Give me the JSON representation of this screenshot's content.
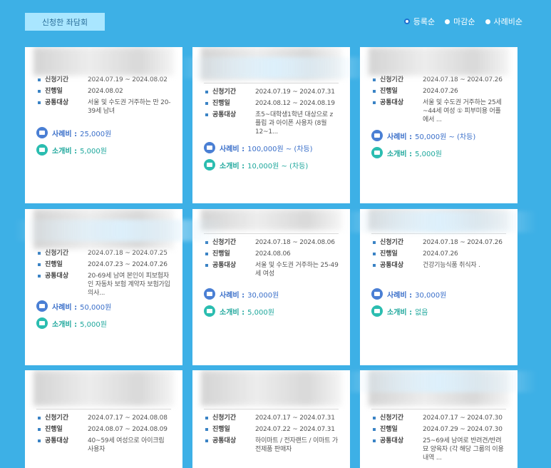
{
  "header": {
    "tab_label": "신청한 좌담회",
    "sort_options": [
      {
        "label": "등록순",
        "selected": true
      },
      {
        "label": "마감순",
        "selected": false
      },
      {
        "label": "사례비순",
        "selected": false
      }
    ]
  },
  "labels": {
    "period": "신청기간",
    "date": "진행일",
    "target": "공통대상",
    "fee": "사례비 :",
    "referral": "소개비 :"
  },
  "cards": [
    {
      "period": "2024.07.19 ~ 2024.08.02",
      "date": "2024.08.02",
      "target": "서울 및 수도권 거주하는 만 20-39세 남녀",
      "fee": "25,000원",
      "referral": "5,000원"
    },
    {
      "period": "2024.07.19 ~ 2024.07.31",
      "date": "2024.08.12 ~ 2024.08.19",
      "target": "초5~대학생1학년 대상으로 z플립 과 아이폰 사용자 (8월 12~1...",
      "fee": "100,000원 ~ (차등)",
      "referral": "10,000원 ~ (차등)"
    },
    {
      "period": "2024.07.18 ~ 2024.07.26",
      "date": "2024.07.26",
      "target": "서울 및 수도권 거주하는 25세~44세 여성 ① 피부미용 어플에서 ...",
      "fee": "50,000원 ~ (차등)",
      "referral": "5,000원"
    },
    {
      "period": "2024.07.18 ~ 2024.07.25",
      "date": "2024.07.23 ~ 2024.07.26",
      "target": "20-69세 남여 본인이 피보험자인 자동차 보험 계약자 보험가입 의사...",
      "fee": "50,000원",
      "referral": "5,000원"
    },
    {
      "period": "2024.07.18 ~ 2024.08.06",
      "date": "2024.08.06",
      "target": "서울 및 수도권 거주하는 25-49세 여성",
      "fee": "30,000원",
      "referral": "5,000원"
    },
    {
      "period": "2024.07.18 ~ 2024.07.26",
      "date": "2024.07.26",
      "target": "건강기능식품 취식자 .",
      "fee": "30,000원",
      "referral": "없음"
    },
    {
      "period": "2024.07.17 ~ 2024.08.08",
      "date": "2024.08.07 ~ 2024.08.09",
      "target": "40~59세 여성으로 아이크림 사용자"
    },
    {
      "period": "2024.07.17 ~ 2024.07.31",
      "date": "2024.07.22 ~ 2024.07.31",
      "target": "하이마트 / 전자랜드 / 이마트 가전제품 판매자"
    },
    {
      "period": "2024.07.17 ~ 2024.07.30",
      "date": "2024.07.29 ~ 2024.07.30",
      "target": "25~69세 남여로 반려견/반려묘 양육자 (각 해당 그룹의 이용 내역 ..."
    }
  ]
}
